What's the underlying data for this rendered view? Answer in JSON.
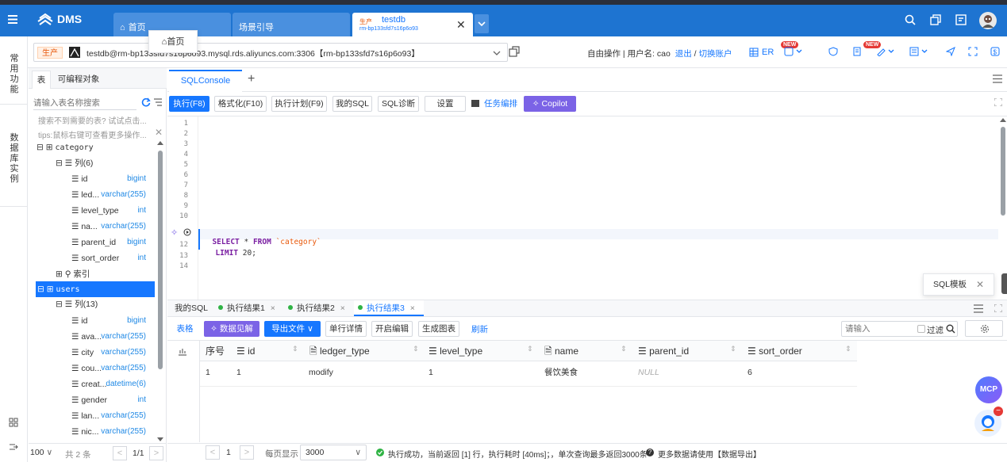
{
  "app": {
    "logo_text": "DMS"
  },
  "top_tabs": [
    {
      "label": "首页"
    },
    {
      "label": "场景引导"
    },
    {
      "env": "生产",
      "title": "testdb",
      "subtitle": "rm-bp133sfd7s16p6o93"
    }
  ],
  "tooltip_home": "首页",
  "connection": {
    "env_badge": "生产",
    "text": "testdb@rm-bp133sfd7s16p6o93.mysql.rds.aliyuncs.com:3306【rm-bp133sfd7s16p6o93】",
    "mode": "自由操作",
    "user_label": "用户名: cao",
    "logout": "退出",
    "switch_account": "切换账户",
    "er": "ER",
    "new_badge": "NEW"
  },
  "rail": {
    "common": "常用功能",
    "db_instance": "数据库实例"
  },
  "left_tabs": {
    "tables": "表",
    "programmable": "可编程对象"
  },
  "search": {
    "placeholder": "请输入表名称搜索"
  },
  "hints": {
    "not_found": "搜索不到需要的表? 试试点击...",
    "tips": "tips:鼠标右键可查看更多操作..."
  },
  "tree": {
    "category": {
      "name": "category",
      "columns_label": "列(6)",
      "columns": [
        {
          "name": "id",
          "type": "bigint"
        },
        {
          "name": "led...",
          "type": "varchar(255)"
        },
        {
          "name": "level_type",
          "type": "int"
        },
        {
          "name": "na...",
          "type": "varchar(255)"
        },
        {
          "name": "parent_id",
          "type": "bigint"
        },
        {
          "name": "sort_order",
          "type": "int"
        }
      ],
      "index_label": "索引"
    },
    "users": {
      "name": "users",
      "columns_label": "列(13)",
      "columns": [
        {
          "name": "id",
          "type": "bigint"
        },
        {
          "name": "ava...",
          "type": "varchar(255)"
        },
        {
          "name": "city",
          "type": "varchar(255)"
        },
        {
          "name": "cou...",
          "type": "varchar(255)"
        },
        {
          "name": "creat...",
          "type": "datetime(6)"
        },
        {
          "name": "gender",
          "type": "int"
        },
        {
          "name": "lan...",
          "type": "varchar(255)"
        },
        {
          "name": "nic...",
          "type": "varchar(255)"
        }
      ]
    }
  },
  "left_footer": {
    "page_size": "100",
    "total": "共 2 条",
    "page": "1/1"
  },
  "editor_tab": "SQLConsole",
  "toolbar": {
    "run": "执行(F8)",
    "format": "格式化(F10)",
    "plan": "执行计划(F9)",
    "my_sql": "我的SQL",
    "diagnose": "SQL诊断",
    "settings": "设置",
    "task": "任务编排",
    "copilot": "Copilot"
  },
  "code": {
    "line_numbers": [
      "1",
      "2",
      "3",
      "4",
      "5",
      "6",
      "7",
      "8",
      "9",
      "10",
      "11",
      "12",
      "13",
      "14"
    ],
    "kw_select": "SELECT",
    "star": " * ",
    "kw_from": "FROM",
    "table": "`category`",
    "kw_limit": "LIMIT",
    "limit_value": " 20;"
  },
  "sql_template": "SQL模板",
  "result_tabs": [
    "我的SQL",
    "执行结果1",
    "执行结果2",
    "执行结果3"
  ],
  "result_toolbar": {
    "table": "表格",
    "insight": "数据见解",
    "export": "导出文件",
    "row_detail": "单行详情",
    "edit": "开启编辑",
    "chart": "生成图表",
    "refresh": "刷新",
    "search_placeholder": "请输入",
    "filter": "过滤"
  },
  "grid": {
    "columns": [
      "序号",
      "id",
      "ledger_type",
      "level_type",
      "name",
      "parent_id",
      "sort_order"
    ],
    "rows": [
      [
        "1",
        "1",
        "modify",
        "1",
        "餐饮美食",
        "NULL",
        "6"
      ]
    ]
  },
  "status": {
    "page": "1",
    "per_page_label": "每页显示",
    "per_page_value": "3000",
    "message": "执行成功，当前返回 [1] 行，执行耗时 [40ms]；，单次查询最多返回3000条",
    "more": "更多数据请使用【数据导出】"
  },
  "colors": {
    "brand": "#1e74d1",
    "primary": "#1677ff",
    "purple": "#7b63e6",
    "success": "#2fb344",
    "danger": "#e53935"
  }
}
